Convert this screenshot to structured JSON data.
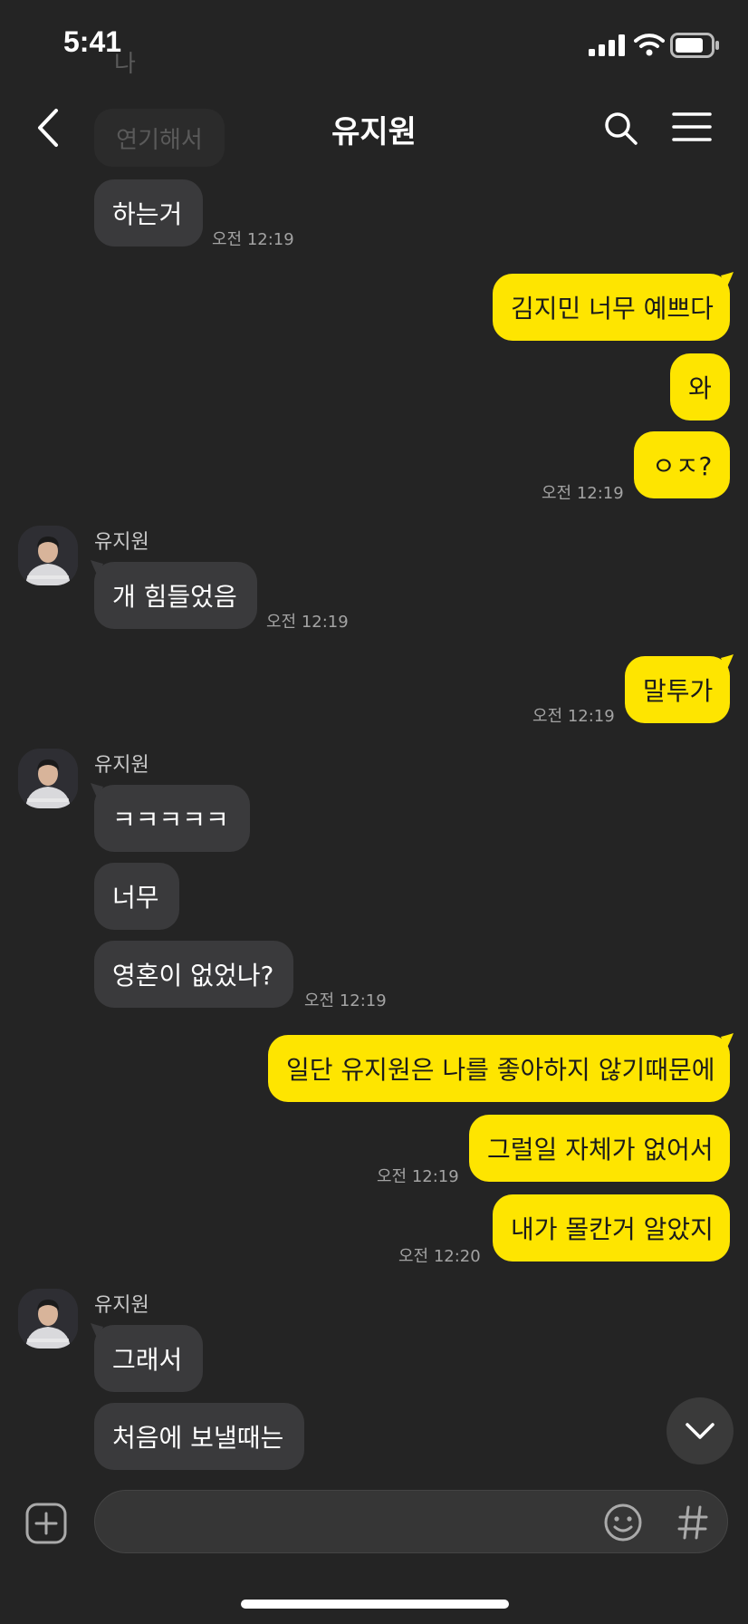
{
  "status_bar": {
    "time": "5:41"
  },
  "header": {
    "title": "유지원",
    "ghost_top": "나",
    "ghost_prev": "연기해서"
  },
  "messages": {
    "m1": {
      "text": "하는거",
      "time": "오전 12:19"
    },
    "m2": {
      "text": "김지민 너무 예쁘다"
    },
    "m3": {
      "text": "와"
    },
    "m4": {
      "text": "ㅇㅈ?",
      "time": "오전 12:19"
    },
    "g1": {
      "sender": "유지원"
    },
    "m5": {
      "text": "개 힘들었음",
      "time": "오전 12:19"
    },
    "m6": {
      "text": "말투가",
      "time": "오전 12:19"
    },
    "g2": {
      "sender": "유지원"
    },
    "m7": {
      "text": "ㅋㅋㅋㅋㅋ"
    },
    "m8": {
      "text": "너무"
    },
    "m9": {
      "text": "영혼이 없었나?",
      "time": "오전 12:19"
    },
    "m10": {
      "text": "일단 유지원은 나를 좋아하지 않기때문에"
    },
    "m11": {
      "text": "그럴일 자체가 없어서",
      "time": "오전 12:19"
    },
    "m12": {
      "text": "내가 몰칸거 알았지",
      "time": "오전 12:20"
    },
    "g3": {
      "sender": "유지원"
    },
    "m13": {
      "text": "그래서"
    },
    "m14": {
      "text": "처음에 보낼때는"
    }
  },
  "icons": {
    "back": "back-chevron-icon",
    "search": "search-icon",
    "menu": "hamburger-menu-icon",
    "scroll_down": "chevron-down-icon",
    "add": "plus-square-icon",
    "emoji": "emoji-icon",
    "hashtag": "hashtag-icon"
  },
  "colors": {
    "background": "#242424",
    "incoming_bubble": "#3a3a3c",
    "outgoing_bubble": "#fee500"
  }
}
